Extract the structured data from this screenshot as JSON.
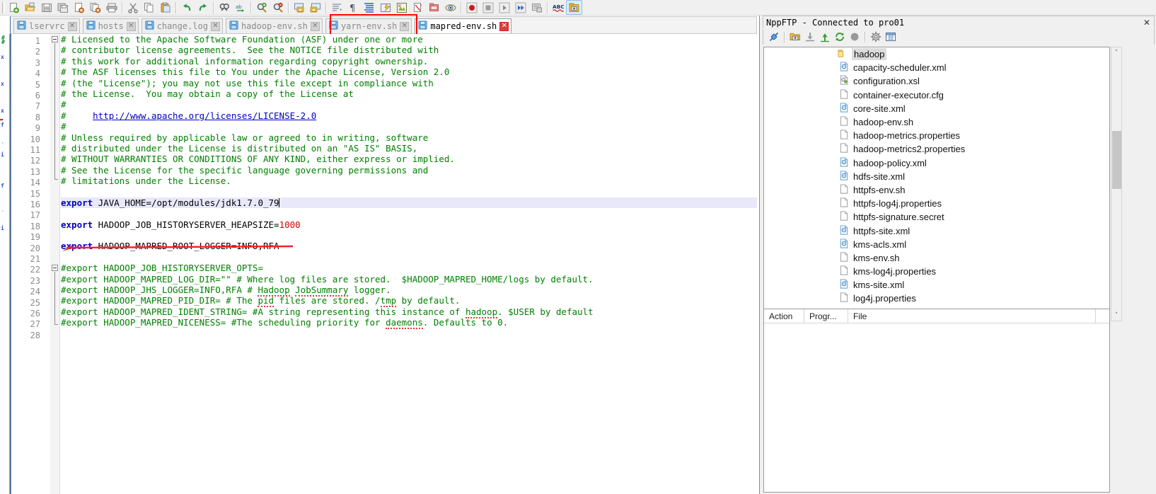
{
  "window": {
    "app": "Notepad++"
  },
  "toolbar": {
    "items": [
      {
        "name": "new-file-icon",
        "label": "New"
      },
      {
        "name": "open-file-icon",
        "label": "Open"
      },
      {
        "name": "save-icon",
        "label": "Save"
      },
      {
        "name": "save-all-icon",
        "label": "Save All"
      },
      {
        "name": "close-file-icon",
        "label": "Close"
      },
      {
        "name": "close-all-icon",
        "label": "Close All"
      },
      {
        "name": "print-icon",
        "label": "Print"
      },
      {
        "sep": true
      },
      {
        "name": "cut-icon",
        "label": "Cut"
      },
      {
        "name": "copy-icon",
        "label": "Copy"
      },
      {
        "name": "paste-icon",
        "label": "Paste"
      },
      {
        "sep": true
      },
      {
        "name": "undo-icon",
        "label": "Undo"
      },
      {
        "name": "redo-icon",
        "label": "Redo"
      },
      {
        "sep": true
      },
      {
        "name": "find-icon",
        "label": "Find"
      },
      {
        "name": "replace-icon",
        "label": "Replace"
      },
      {
        "sep": true
      },
      {
        "name": "zoom-in-icon",
        "label": "Zoom In"
      },
      {
        "name": "zoom-out-icon",
        "label": "Zoom Out"
      },
      {
        "sep": true
      },
      {
        "name": "sync-vertical-scroll-icon",
        "label": "Synchronize Vertical Scrolling"
      },
      {
        "name": "sync-horizontal-scroll-icon",
        "label": "Synchronize Horizontal Scrolling"
      },
      {
        "sep": true
      },
      {
        "name": "word-wrap-icon",
        "label": "Word Wrap"
      },
      {
        "name": "show-all-characters-icon",
        "label": "Show All Characters"
      },
      {
        "name": "indent-guide-icon",
        "label": "Show Indent Guide"
      },
      {
        "name": "user-defined-language-icon",
        "label": "User Defined Dialogue"
      },
      {
        "name": "document-map-icon",
        "label": "Document Map"
      },
      {
        "name": "function-list-icon",
        "label": "Function List"
      },
      {
        "name": "folder-as-workspace-icon",
        "label": "Folder as Workspace"
      },
      {
        "name": "monitoring-icon",
        "label": "Monitoring"
      },
      {
        "sep": true
      },
      {
        "name": "record-macro-icon",
        "label": "Start Recording"
      },
      {
        "name": "stop-macro-icon",
        "label": "Stop Recording"
      },
      {
        "name": "play-macro-icon",
        "label": "Playback"
      },
      {
        "name": "run-macro-multiple-icon",
        "label": "Run a Macro Multiple Times"
      },
      {
        "name": "save-macro-icon",
        "label": "Save Current Recorded Macro"
      },
      {
        "sep": true
      },
      {
        "name": "spell-check-icon",
        "label": "ABC"
      },
      {
        "name": "nppftp-toggle-icon",
        "label": "NppFTP",
        "active": true
      }
    ]
  },
  "tabs": [
    {
      "label": "lservrc",
      "active": false
    },
    {
      "label": "hosts",
      "active": false
    },
    {
      "label": "change.log",
      "active": false
    },
    {
      "label": "hadoop-env.sh",
      "active": false
    },
    {
      "label": "yarn-env.sh",
      "active": false
    },
    {
      "label": "mapred-env.sh",
      "active": true
    }
  ],
  "editor": {
    "current_line": 16,
    "total_lines": 28,
    "line_numbers": [
      "1",
      "2",
      "3",
      "4",
      "5",
      "6",
      "7",
      "8",
      "9",
      "10",
      "11",
      "12",
      "13",
      "14",
      "15",
      "16",
      "17",
      "18",
      "19",
      "20",
      "21",
      "22",
      "23",
      "24",
      "25",
      "26",
      "27",
      "28"
    ],
    "lines": [
      "# Licensed to the Apache Software Foundation (ASF) under one or more",
      "# contributor license agreements.  See the NOTICE file distributed with",
      "# this work for additional information regarding copyright ownership.",
      "# The ASF licenses this file to You under the Apache License, Version 2.0",
      "# (the \"License\"); you may not use this file except in compliance with",
      "# the License.  You may obtain a copy of the License at",
      "#",
      "#     http://www.apache.org/licenses/LICENSE-2.0",
      "#",
      "# Unless required by applicable law or agreed to in writing, software",
      "# distributed under the License is distributed on an \"AS IS\" BASIS,",
      "# WITHOUT WARRANTIES OR CONDITIONS OF ANY KIND, either express or implied.",
      "# See the License for the specific language governing permissions and",
      "# limitations under the License.",
      "",
      "export JAVA_HOME=/opt/modules/jdk1.7.0_79",
      "",
      "export HADOOP_JOB_HISTORYSERVER_HEAPSIZE=1000",
      "",
      "export HADOOP_MAPRED_ROOT_LOGGER=INFO,RFA",
      "",
      "#export HADOOP_JOB_HISTORYSERVER_OPTS=",
      "#export HADOOP_MAPRED_LOG_DIR=\"\" # Where log files are stored.  $HADOOP_MAPRED_HOME/logs by default.",
      "#export HADOOP_JHS_LOGGER=INFO,RFA # Hadoop JobSummary logger.",
      "#export HADOOP_MAPRED_PID_DIR= # The pid files are stored. /tmp by default.",
      "#export HADOOP_MAPRED_IDENT_STRING= #A string representing this instance of hadoop. $USER by default",
      "#export HADOOP_MAPRED_NICENESS= #The scheduling priority for daemons. Defaults to 0.",
      ""
    ],
    "url_line_text": "http://www.apache.org/licenses/LICENSE-2.0",
    "annotation": "red-underline-arrow"
  },
  "nppftp": {
    "title": "NppFTP - Connected to pro01",
    "close_label": "✕",
    "toolbar": [
      {
        "name": "connect-icon",
        "label": "(Dis)connect"
      },
      {
        "sep": true
      },
      {
        "name": "open-folder-icon",
        "label": "Open directory"
      },
      {
        "name": "download-icon",
        "label": "Download"
      },
      {
        "name": "upload-icon",
        "label": "Upload"
      },
      {
        "name": "refresh-icon",
        "label": "Refresh"
      },
      {
        "name": "abort-icon",
        "label": "Abort"
      },
      {
        "sep": true
      },
      {
        "name": "settings-icon",
        "label": "Settings"
      },
      {
        "name": "messages-icon",
        "label": "Messages"
      }
    ],
    "tree": [
      {
        "label": "hadoop",
        "type": "folder",
        "selected": true
      },
      {
        "label": "capacity-scheduler.xml",
        "type": "xml"
      },
      {
        "label": "configuration.xsl",
        "type": "xsl"
      },
      {
        "label": "container-executor.cfg",
        "type": "file"
      },
      {
        "label": "core-site.xml",
        "type": "xml"
      },
      {
        "label": "hadoop-env.sh",
        "type": "file"
      },
      {
        "label": "hadoop-metrics.properties",
        "type": "file"
      },
      {
        "label": "hadoop-metrics2.properties",
        "type": "file"
      },
      {
        "label": "hadoop-policy.xml",
        "type": "xml"
      },
      {
        "label": "hdfs-site.xml",
        "type": "xml"
      },
      {
        "label": "httpfs-env.sh",
        "type": "file"
      },
      {
        "label": "httpfs-log4j.properties",
        "type": "file"
      },
      {
        "label": "httpfs-signature.secret",
        "type": "file"
      },
      {
        "label": "httpfs-site.xml",
        "type": "xml"
      },
      {
        "label": "kms-acls.xml",
        "type": "xml"
      },
      {
        "label": "kms-env.sh",
        "type": "file"
      },
      {
        "label": "kms-log4j.properties",
        "type": "file"
      },
      {
        "label": "kms-site.xml",
        "type": "xml"
      },
      {
        "label": "log4j.properties",
        "type": "file"
      }
    ],
    "queue_columns": [
      "Action",
      "Progr...",
      "File"
    ],
    "queue_rows": []
  },
  "colors": {
    "comment": "#008000",
    "keyword": "#0000c0",
    "number": "#d00000",
    "annotation": "#ff0000",
    "current_line": "#e8e8fa",
    "tab_active_close": "#e03b3b"
  }
}
